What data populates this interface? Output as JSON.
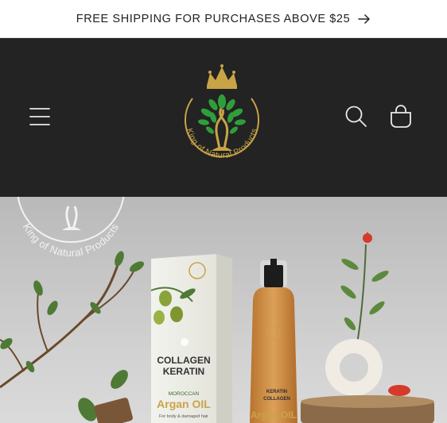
{
  "announcement": {
    "text": "FREE SHIPPING FOR PURCHASES ABOVE $25",
    "arrow_icon": "arrow-right-icon"
  },
  "header": {
    "menu_icon": "hamburger-menu-icon",
    "search_icon": "search-icon",
    "cart_icon": "shopping-bag-icon",
    "logo": {
      "brand_text": "King of Natural Products",
      "colors": {
        "gold": "#c9a447",
        "leaf": "#2f9e3a"
      }
    },
    "background": "#232323"
  },
  "hero": {
    "watermark_text": "King of Natural Products",
    "box": {
      "title_line1": "COLLAGEN",
      "title_line2": "KERATIN",
      "subtitle": "MOROCCAN",
      "product": "Argan OIL",
      "caption": "For body & damaged hair"
    },
    "bottle": {
      "label_line1": "KERATIN",
      "label_line2": "COLLAGEN",
      "product": "Argan OIL"
    }
  }
}
